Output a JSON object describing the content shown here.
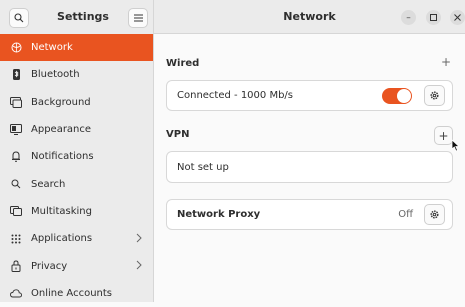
{
  "sidebar": {
    "title": "Settings",
    "items": [
      {
        "label": "Network",
        "icon": "network-icon",
        "active": true
      },
      {
        "label": "Bluetooth",
        "icon": "bluetooth-icon"
      },
      {
        "label": "Background",
        "icon": "background-icon"
      },
      {
        "label": "Appearance",
        "icon": "appearance-icon"
      },
      {
        "label": "Notifications",
        "icon": "bell-icon"
      },
      {
        "label": "Search",
        "icon": "search-icon"
      },
      {
        "label": "Multitasking",
        "icon": "multitasking-icon"
      },
      {
        "label": "Applications",
        "icon": "apps-grid-icon",
        "chevron": true
      },
      {
        "label": "Privacy",
        "icon": "lock-icon",
        "chevron": true
      },
      {
        "label": "Online Accounts",
        "icon": "cloud-icon"
      }
    ]
  },
  "header": {
    "title": "Network"
  },
  "wired": {
    "title": "Wired",
    "connection": "Connected - 1000 Mb/s",
    "enabled": true
  },
  "vpn": {
    "title": "VPN",
    "status": "Not set up"
  },
  "proxy": {
    "title": "Network Proxy",
    "status": "Off"
  },
  "colors": {
    "accent": "#e95420"
  }
}
